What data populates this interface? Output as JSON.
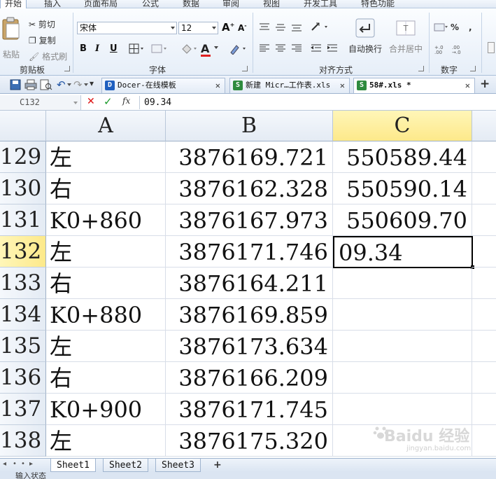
{
  "menu": {
    "tabs": [
      "开始",
      "插入",
      "页面布局",
      "公式",
      "数据",
      "审阅",
      "视图",
      "开发工具",
      "特色功能"
    ],
    "active_tab": "开始"
  },
  "ribbon": {
    "clipboard": {
      "label": "剪贴板",
      "paste": "粘贴",
      "cut": "剪切",
      "copy": "复制",
      "format_painter": "格式刷"
    },
    "font": {
      "label": "字体",
      "font_name": "宋体",
      "font_size": "12",
      "grow": "A",
      "shrink": "A",
      "bold": "B",
      "italic": "I",
      "underline": "U",
      "font_color_letter": "A"
    },
    "alignment": {
      "label": "对齐方式",
      "wrap_text": "自动换行",
      "merge_center": "合并居中"
    },
    "number": {
      "label": "数字",
      "percent": "%"
    }
  },
  "doc_tabs": [
    {
      "title": "Docer-在线模板",
      "active": false
    },
    {
      "title": "新建 Micr…工作表.xls",
      "active": false
    },
    {
      "title": "58#.xls *",
      "active": true
    }
  ],
  "formula_bar": {
    "name_box": "C132",
    "cancel": "✕",
    "confirm": "✓",
    "fx": "fx",
    "value": "09.34"
  },
  "grid": {
    "columns": [
      "A",
      "B",
      "C"
    ],
    "selected_column": "C",
    "selected_row": "132",
    "rows": [
      {
        "row": "129",
        "a": "左",
        "b": "3876169.721",
        "c": "550589.44"
      },
      {
        "row": "130",
        "a": "右",
        "b": "3876162.328",
        "c": "550590.14"
      },
      {
        "row": "131",
        "a": "K0+860",
        "b": "3876167.973",
        "c": "550609.70"
      },
      {
        "row": "132",
        "a": "左",
        "b": "3876171.746",
        "c": "09.34"
      },
      {
        "row": "133",
        "a": "右",
        "b": "3876164.211",
        "c": ""
      },
      {
        "row": "134",
        "a": "K0+880",
        "b": "3876169.859",
        "c": ""
      },
      {
        "row": "135",
        "a": "左",
        "b": "3876173.634",
        "c": ""
      },
      {
        "row": "136",
        "a": "右",
        "b": "3876166.209",
        "c": ""
      },
      {
        "row": "137",
        "a": "K0+900",
        "b": "3876171.745",
        "c": ""
      },
      {
        "row": "138",
        "a": "左",
        "b": "3876175.320",
        "c": ""
      }
    ]
  },
  "sheets": [
    "Sheet1",
    "Sheet2",
    "Sheet3"
  ],
  "active_sheet": "Sheet1",
  "add_sheet": "+",
  "status": "输入状态",
  "watermark": {
    "main": "Baidu 经验",
    "sub": "jingyan.baidu.com"
  },
  "colors": {
    "selected_header": "#fde98a",
    "font_color_bar": "#e02020",
    "ribbon_border": "#a9bfd9"
  }
}
